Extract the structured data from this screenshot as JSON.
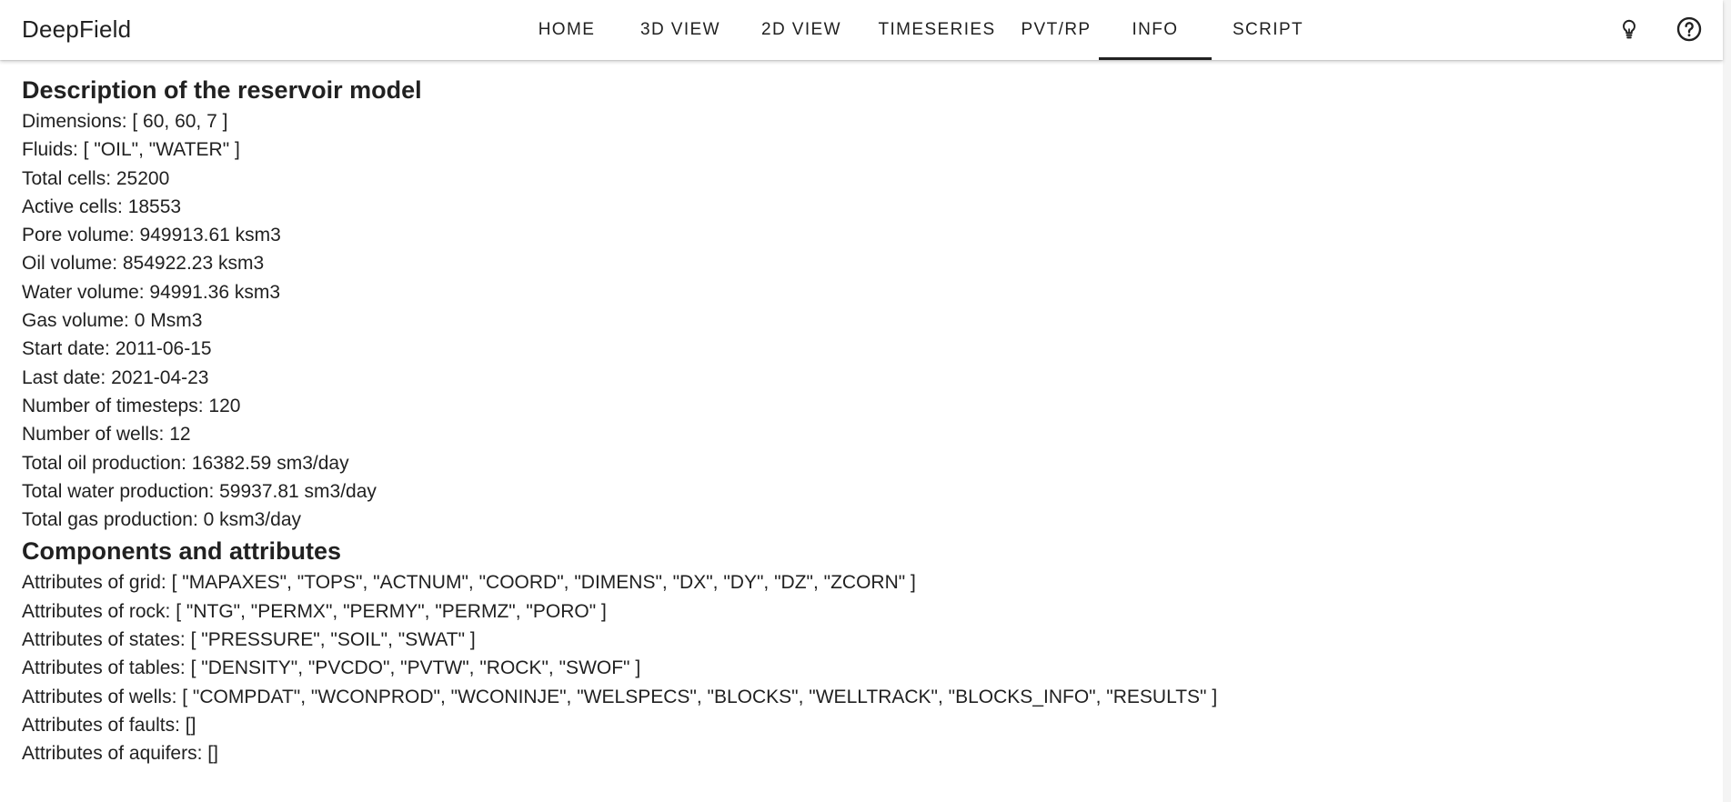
{
  "app": {
    "title": "DeepField"
  },
  "nav": {
    "tabs": [
      {
        "label": "HOME",
        "active": false
      },
      {
        "label": "3D VIEW",
        "active": false
      },
      {
        "label": "2D VIEW",
        "active": false
      },
      {
        "label": "TIMESERIES",
        "active": false
      },
      {
        "label": "PVT/RP",
        "active": false
      },
      {
        "label": "INFO",
        "active": true
      },
      {
        "label": "SCRIPT",
        "active": false
      }
    ],
    "icons": [
      "lightbulb-icon",
      "help-circle-icon"
    ]
  },
  "description": {
    "heading": "Description of the reservoir model",
    "lines": [
      "Dimensions: [ 60, 60, 7 ]",
      "Fluids: [ \"OIL\", \"WATER\" ]",
      "Total cells: 25200",
      "Active cells: 18553",
      "Pore volume: 949913.61 ksm3",
      "Oil volume: 854922.23 ksm3",
      "Water volume: 94991.36 ksm3",
      "Gas volume: 0 Msm3",
      "Start date: 2011-06-15",
      "Last date: 2021-04-23",
      "Number of timesteps: 120",
      "Number of wells: 12",
      "Total oil production: 16382.59 sm3/day",
      "Total water production: 59937.81 sm3/day",
      "Total gas production: 0 ksm3/day"
    ]
  },
  "components": {
    "heading": "Components and attributes",
    "lines": [
      "Attributes of grid: [ \"MAPAXES\", \"TOPS\", \"ACTNUM\", \"COORD\", \"DIMENS\", \"DX\", \"DY\", \"DZ\", \"ZCORN\" ]",
      "Attributes of rock: [ \"NTG\", \"PERMX\", \"PERMY\", \"PERMZ\", \"PORO\" ]",
      "Attributes of states: [ \"PRESSURE\", \"SOIL\", \"SWAT\" ]",
      "Attributes of tables: [ \"DENSITY\", \"PVCDO\", \"PVTW\", \"ROCK\", \"SWOF\" ]",
      "Attributes of wells: [ \"COMPDAT\", \"WCONPROD\", \"WCONINJE\", \"WELSPECS\", \"BLOCKS\", \"WELLTRACK\", \"BLOCKS_INFO\", \"RESULTS\" ]",
      "Attributes of faults: []",
      "Attributes of aquifers: []"
    ]
  }
}
